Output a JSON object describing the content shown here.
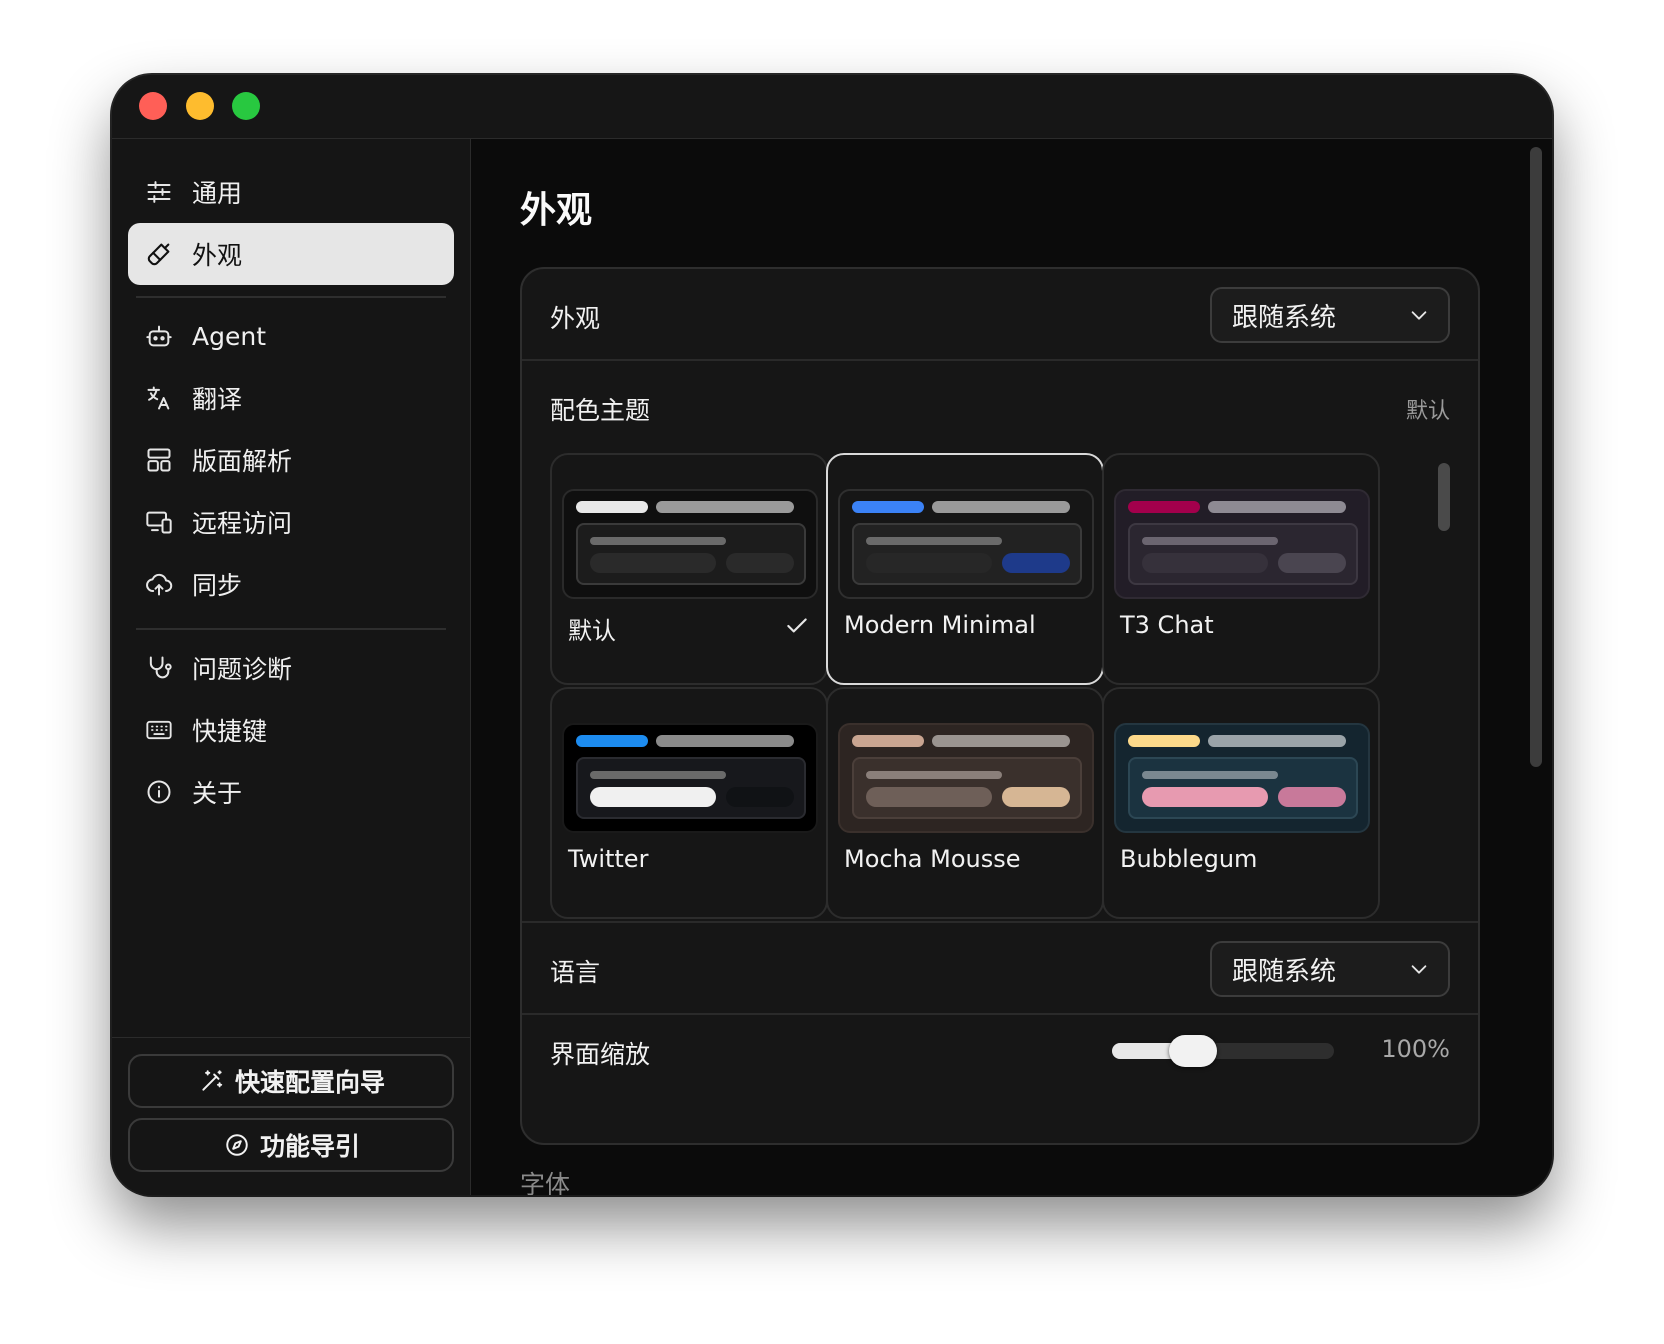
{
  "sidebar": {
    "items": [
      {
        "label": "通用",
        "icon": "sliders-icon"
      },
      {
        "label": "外观",
        "icon": "paintbrush-icon",
        "active": true
      },
      {
        "label": "Agent",
        "icon": "robot-icon"
      },
      {
        "label": "翻译",
        "icon": "translate-icon"
      },
      {
        "label": "版面解析",
        "icon": "layout-icon"
      },
      {
        "label": "远程访问",
        "icon": "remote-access-icon"
      },
      {
        "label": "同步",
        "icon": "cloud-sync-icon"
      },
      {
        "label": "问题诊断",
        "icon": "stethoscope-icon"
      },
      {
        "label": "快捷键",
        "icon": "keyboard-icon"
      },
      {
        "label": "关于",
        "icon": "info-icon"
      }
    ],
    "bottom": {
      "wizard_label": "快速配置向导",
      "guide_label": "功能导引"
    }
  },
  "main": {
    "title": "外观",
    "appearance": {
      "label": "外观",
      "value": "跟随系统"
    },
    "themes": {
      "label": "配色主题",
      "current": "默认",
      "items": [
        {
          "name": "默认",
          "selected_check": true
        },
        {
          "name": "Modern Minimal",
          "focused": true
        },
        {
          "name": "T3 Chat"
        },
        {
          "name": "Twitter"
        },
        {
          "name": "Mocha Mousse"
        },
        {
          "name": "Bubblegum"
        }
      ]
    },
    "language": {
      "label": "语言",
      "value": "跟随系统"
    },
    "zoom": {
      "label": "界面缩放",
      "value_text": "100%",
      "level": 0.33
    },
    "next_section": "字体"
  },
  "colors": {
    "close": "#ff5f57",
    "minimize": "#febc2e",
    "maximize": "#28c840"
  }
}
